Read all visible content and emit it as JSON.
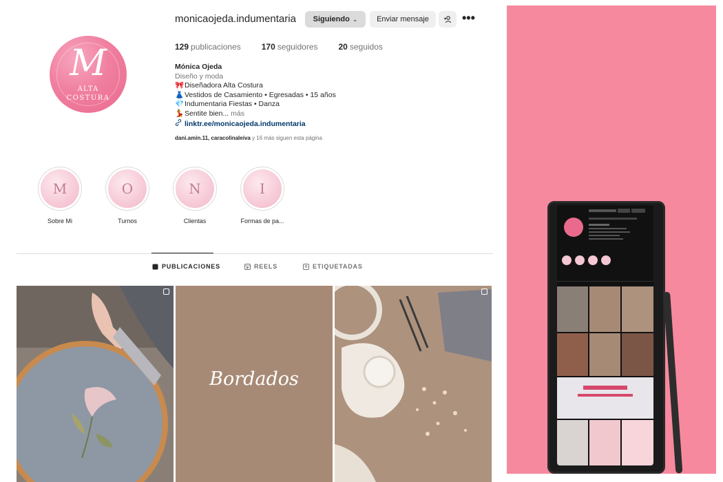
{
  "profile": {
    "username": "monicaojeda.indumentaria",
    "following_label": "Siguiendo",
    "message_label": "Enviar mensaje",
    "more_glyph": "•••",
    "avatar": {
      "monogram": "M",
      "line1": "ALTA",
      "line2": "COSTURA"
    },
    "stats": {
      "posts_count": "129",
      "posts_label": "publicaciones",
      "followers_count": "170",
      "followers_label": "seguidores",
      "following_count": "20",
      "following_label": "seguidos"
    },
    "bio": {
      "name": "Mónica Ojeda",
      "category": "Diseño y moda",
      "lines": [
        {
          "emoji": "🎀",
          "text": "Diseñadora Alta Costura"
        },
        {
          "emoji": "👗",
          "text": "Vestidos de Casamiento • Egresadas • 15 años"
        },
        {
          "emoji": "💎",
          "text": "Indumentaria Fiestas • Danza"
        },
        {
          "emoji": "💃",
          "text": "Sentite bien..."
        }
      ],
      "more": "más",
      "link": "linktr.ee/monicaojeda.indumentaria"
    },
    "followed_by": {
      "users": "dani.amin.11, caracolinaleiva",
      "rest": "y 16 más siguen esta página"
    }
  },
  "highlights": [
    {
      "letter": "M",
      "label": "Sobre Mi"
    },
    {
      "letter": "O",
      "label": "Turnos"
    },
    {
      "letter": "N",
      "label": "Clientas"
    },
    {
      "letter": "I",
      "label": "Formas de pa..."
    }
  ],
  "tabs": [
    {
      "label": "PUBLICACIONES",
      "active": true
    },
    {
      "label": "REELS",
      "active": false
    },
    {
      "label": "ETIQUETADAS",
      "active": false
    }
  ],
  "posts": [
    {
      "kind": "photo",
      "subject": "embroidery-hoop"
    },
    {
      "kind": "text",
      "text": "Bordados"
    },
    {
      "kind": "photo",
      "subject": "lace-and-beads"
    }
  ],
  "colors": {
    "accent_pink": "#f7899f",
    "avatar_pink": "#ea6a8e",
    "link_blue": "#00376b"
  }
}
